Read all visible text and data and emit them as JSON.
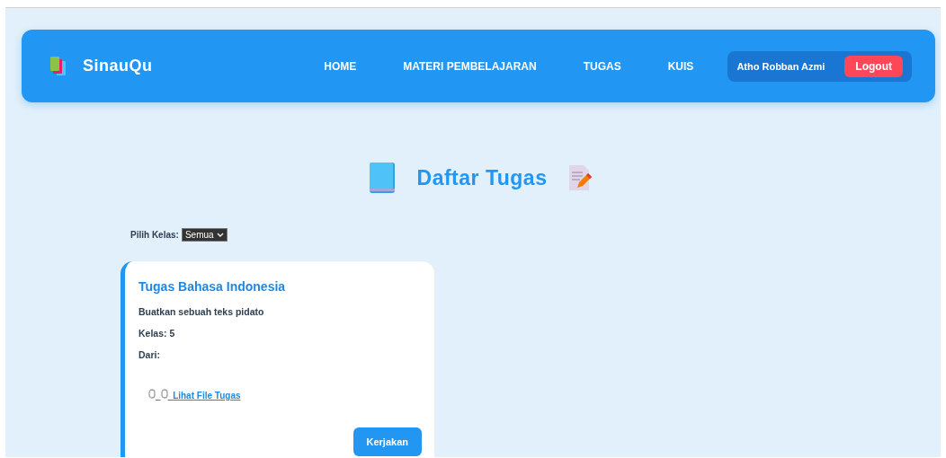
{
  "navbar": {
    "brand": "SinauQu",
    "links": [
      {
        "label": "HOME"
      },
      {
        "label": "MATERI PEMBELAJARAN"
      },
      {
        "label": "TUGAS"
      },
      {
        "label": "KUIS"
      }
    ],
    "user": "Atho Robban Azmi",
    "logout": "Logout"
  },
  "heading": "Daftar Tugas",
  "filter": {
    "label": "Pilih Kelas:",
    "value": "Semua"
  },
  "tasks": [
    {
      "title": "Tugas Bahasa Indonesia",
      "description": "Buatkan sebuah teks pidato",
      "class": "Kelas: 5",
      "from": "Dari:",
      "file_link": "Lihat File Tugas",
      "action": "Kerjakan"
    }
  ]
}
